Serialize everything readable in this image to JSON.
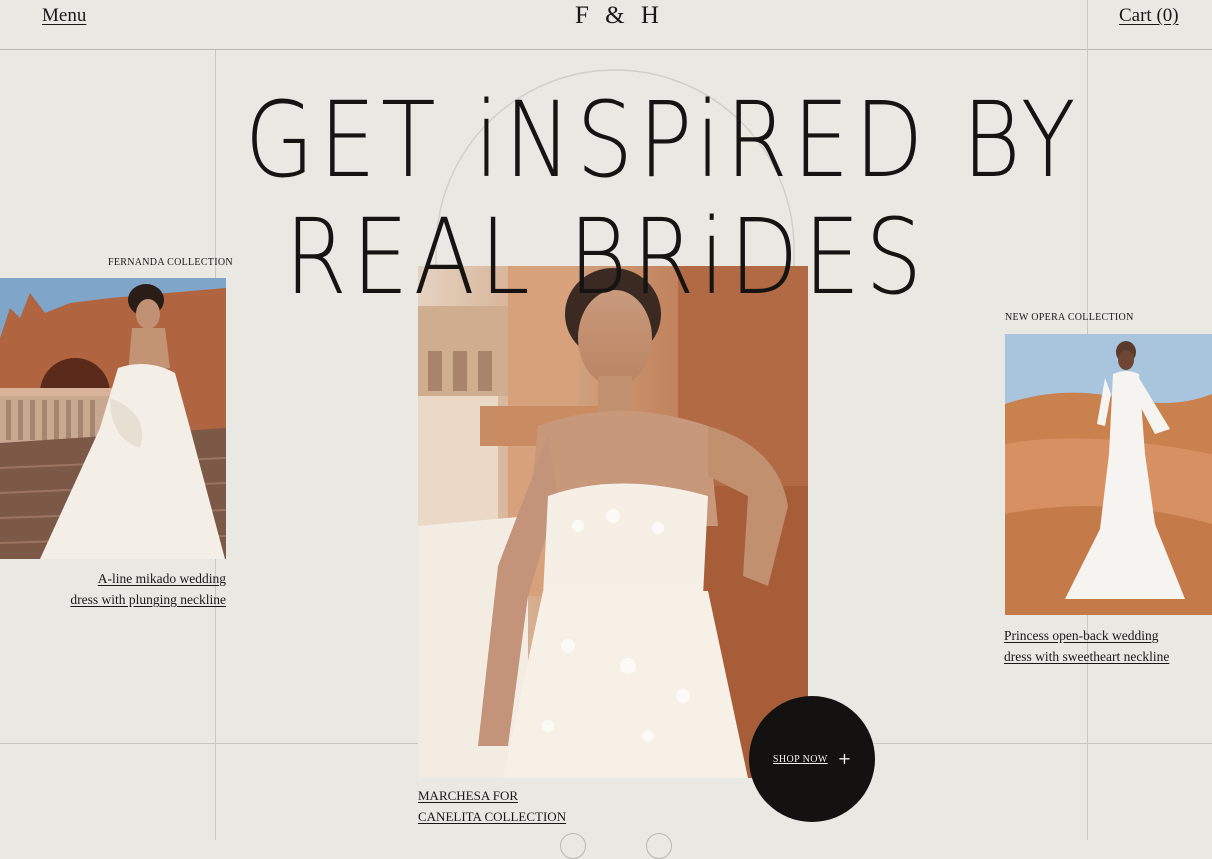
{
  "header": {
    "menu_label": "Menu",
    "logo": "F & H",
    "cart_label": "Cart (0)"
  },
  "hero": {
    "headline_line1": "GET iNSPiRED BY",
    "headline_line2": "REAL BRiDES"
  },
  "cards": {
    "left": {
      "collection": "FERNANDA COLLECTION",
      "title_line1": "A-line mikado wedding",
      "title_line2": "dress with plunging neckline"
    },
    "center": {
      "caption_line1": "MARCHESA FOR",
      "caption_line2": "CANELITA COLLECTION"
    },
    "right": {
      "collection": "NEW OPERA COLLECTION",
      "title_line1": "Princess open-back wedding",
      "title_line2": "dress with sweetheart neckline"
    }
  },
  "cta": {
    "shop_now_label": "SHOP NOW",
    "icon": "plus-icon"
  },
  "colors": {
    "background": "#e9e8e3",
    "text": "#1a1816",
    "button": "#141210",
    "gridline": "#b9b8b2"
  }
}
